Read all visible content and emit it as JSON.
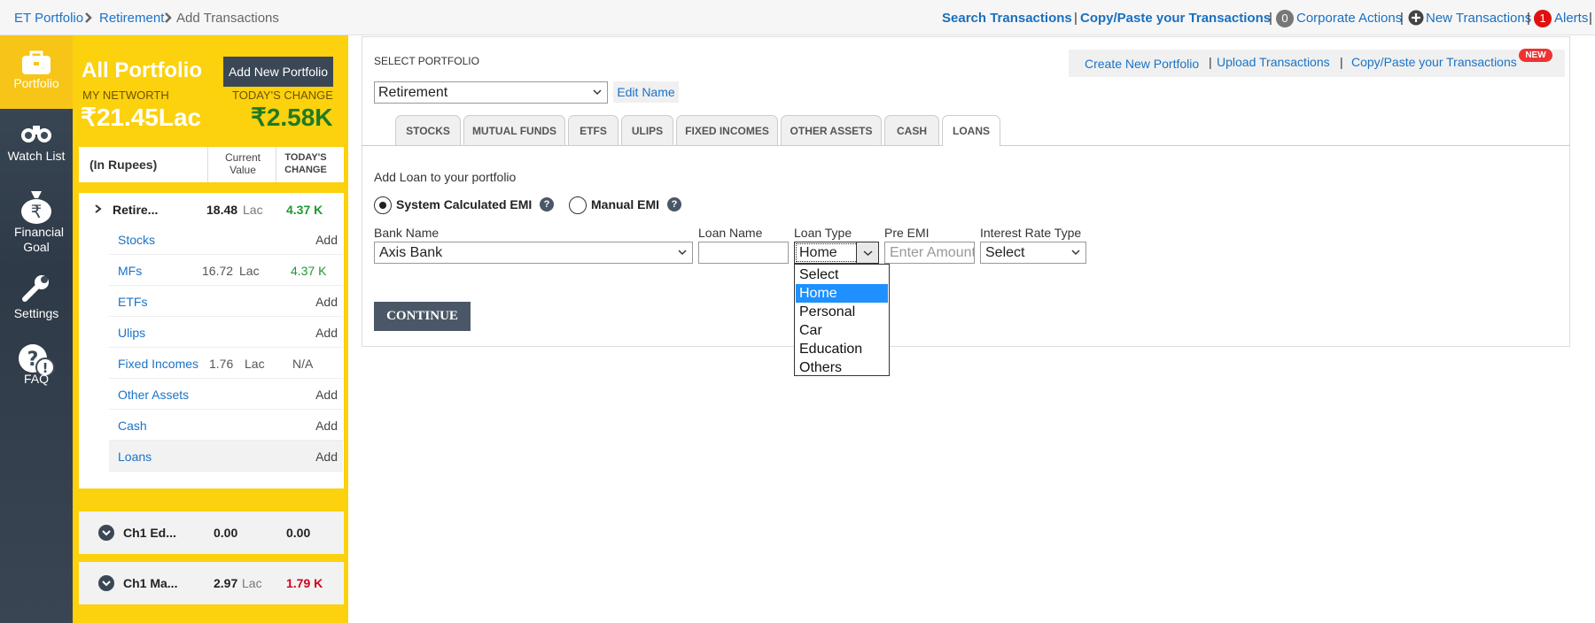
{
  "breadcrumb": {
    "items": [
      "ET Portfolio",
      "Retirement",
      "Add Transactions"
    ]
  },
  "topnav": {
    "search": "Search Transactions",
    "copy_paste": "Copy/Paste your Transactions",
    "corporate_count": "0",
    "corporate": "Corporate Actions",
    "new_transactions": "New Transactions",
    "alerts_count": "1",
    "alerts": "Alerts",
    "separator": "|"
  },
  "sidebar": {
    "items": [
      {
        "label": "Portfolio",
        "icon": "briefcase-icon"
      },
      {
        "label": "Watch List",
        "icon": "binoculars-icon"
      },
      {
        "label": "Financial Goal",
        "icon": "money-bag-icon"
      },
      {
        "label": "Settings",
        "icon": "wrench-icon"
      },
      {
        "label": "FAQ",
        "icon": "question-icon"
      }
    ]
  },
  "summary": {
    "title": "All Portfolio",
    "add_button": "Add New Portfolio",
    "networth_label": "MY NETWORTH",
    "change_label": "TODAY'S CHANGE",
    "networth": "₹21.45Lac",
    "change": "₹2.58K",
    "header": {
      "unit": "(In Rupees)",
      "current": "Current Value",
      "today": "TODAY'S CHANGE"
    }
  },
  "portfolio_list": {
    "selected": {
      "name": "Retire...",
      "value": "18.48",
      "unit": "Lac",
      "change": "4.37 K"
    },
    "rows": [
      {
        "name": "Stocks",
        "value": "",
        "unit": "",
        "change": "Add"
      },
      {
        "name": "MFs",
        "value": "16.72",
        "unit": "Lac",
        "change": "4.37 K"
      },
      {
        "name": "ETFs",
        "value": "",
        "unit": "",
        "change": "Add"
      },
      {
        "name": "Ulips",
        "value": "",
        "unit": "",
        "change": "Add"
      },
      {
        "name": "Fixed Incomes",
        "value": "1.76",
        "unit": "Lac",
        "change": "N/A"
      },
      {
        "name": "Other Assets",
        "value": "",
        "unit": "",
        "change": "Add"
      },
      {
        "name": "Cash",
        "value": "",
        "unit": "",
        "change": "Add"
      },
      {
        "name": "Loans",
        "value": "",
        "unit": "",
        "change": "Add"
      }
    ],
    "others": [
      {
        "name": "Ch1 Ed...",
        "value": "0.00",
        "unit": "",
        "change": "0.00"
      },
      {
        "name": "Ch1 Ma...",
        "value": "2.97",
        "unit": "Lac",
        "change": "1.79 K"
      }
    ]
  },
  "main": {
    "select_label": "SELECT PORTFOLIO",
    "selected_portfolio": "Retirement",
    "edit_name": "Edit Name",
    "links": {
      "create": "Create New Portfolio",
      "upload": "Upload Transactions",
      "copy_paste": "Copy/Paste your Transactions",
      "new_badge": "NEW",
      "sep": "|"
    },
    "tabs": [
      "STOCKS",
      "MUTUAL FUNDS",
      "ETFS",
      "ULIPS",
      "FIXED INCOMES",
      "OTHER ASSETS",
      "CASH",
      "LOANS"
    ],
    "active_tab": "LOANS",
    "form_title": "Add Loan to your portfolio",
    "emi_options": {
      "system": "System Calculated EMI",
      "manual": "Manual EMI",
      "help": "?"
    },
    "fields": {
      "bank_name": {
        "label": "Bank Name",
        "value": "Axis Bank"
      },
      "loan_name": {
        "label": "Loan Name",
        "value": ""
      },
      "loan_type": {
        "label": "Loan Type",
        "value": "Home",
        "options": [
          "Select",
          "Home",
          "Personal",
          "Car",
          "Education",
          "Others"
        ]
      },
      "pre_emi": {
        "label": "Pre EMI",
        "placeholder": "Enter Amount"
      },
      "interest_rate_type": {
        "label": "Interest Rate Type",
        "value": "Select"
      }
    },
    "continue": "CONTINUE"
  },
  "colors": {
    "accent_yellow": "#fcd10e",
    "sidebar": "#3d4a58",
    "link": "#1a73c7",
    "positive": "#1e9a2e",
    "negative": "#d0021b",
    "highlight": "#1e90ff"
  }
}
